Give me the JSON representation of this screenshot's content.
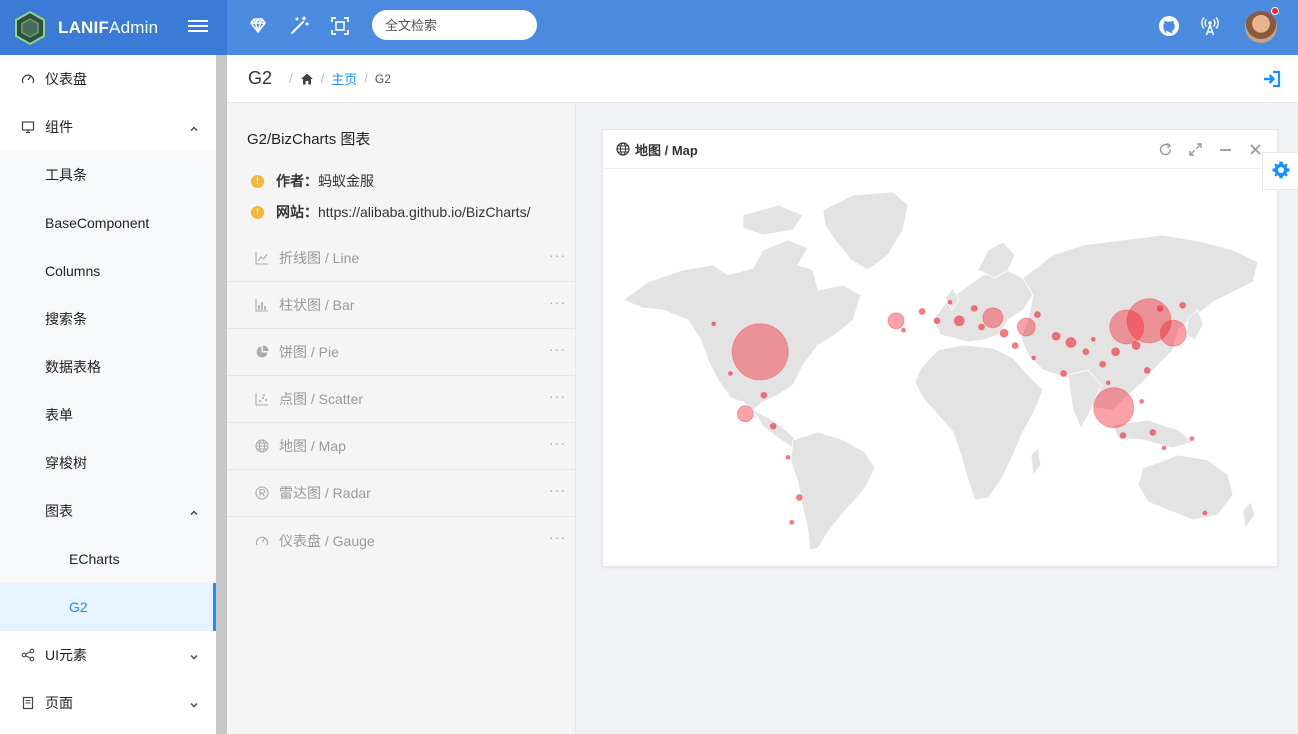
{
  "app": {
    "logo_bold": "LANIF",
    "logo_rest": "Admin"
  },
  "header": {
    "search_placeholder": "全文检索"
  },
  "sidebar": {
    "items": [
      {
        "label": "仪表盘",
        "icon": "dashboard-icon",
        "level": 1
      },
      {
        "label": "组件",
        "icon": "monitor-icon",
        "level": 1,
        "expanded": true
      },
      {
        "label": "工具条",
        "level": 2
      },
      {
        "label": "BaseComponent",
        "level": 2
      },
      {
        "label": "Columns",
        "level": 2
      },
      {
        "label": "搜索条",
        "level": 2
      },
      {
        "label": "数据表格",
        "level": 2
      },
      {
        "label": "表单",
        "level": 2
      },
      {
        "label": "穿梭树",
        "level": 2
      },
      {
        "label": "图表",
        "level": 2,
        "expanded": true
      },
      {
        "label": "ECharts",
        "level": 3
      },
      {
        "label": "G2",
        "level": 3,
        "active": true
      },
      {
        "label": "UI元素",
        "icon": "share-icon",
        "level": 1,
        "expanded": false
      },
      {
        "label": "页面",
        "icon": "page-icon",
        "level": 1,
        "expanded": false
      }
    ]
  },
  "breadcrumb": {
    "title": "G2",
    "sep": "/",
    "home_link": "主页",
    "current": "G2"
  },
  "list_panel": {
    "title": "G2/BizCharts 图表",
    "author_label": "作者：",
    "author_value": "蚂蚁金服",
    "site_label": "网站：",
    "site_value": "https://alibaba.github.io/BizCharts/",
    "more": "···",
    "items": [
      {
        "label": "折线图 / Line",
        "icon": "line-chart-icon"
      },
      {
        "label": "柱状图 / Bar",
        "icon": "bar-chart-icon"
      },
      {
        "label": "饼图 / Pie",
        "icon": "pie-chart-icon"
      },
      {
        "label": "点图 / Scatter",
        "icon": "scatter-chart-icon"
      },
      {
        "label": "地图 / Map",
        "icon": "globe-icon"
      },
      {
        "label": "雷达图 / Radar",
        "icon": "radar-icon"
      },
      {
        "label": "仪表盘 / Gauge",
        "icon": "gauge-icon"
      }
    ]
  },
  "card": {
    "title": "地图 / Map"
  },
  "colors": {
    "header": "#4a8be0",
    "logo_bg": "#3a7bd5",
    "accent": "#1890ff",
    "bubble": "#f5222d",
    "land": "#e3e3e3"
  },
  "chart_data": {
    "type": "bubble-map",
    "points": [
      {
        "lon": -87,
        "lat": 22,
        "size": 28
      },
      {
        "lon": 122,
        "lat": 32,
        "size": 22
      },
      {
        "lon": 110,
        "lat": 30,
        "size": 17
      },
      {
        "lon": 103,
        "lat": 4,
        "size": 20
      },
      {
        "lon": 135,
        "lat": 28,
        "size": 13
      },
      {
        "lon": 38,
        "lat": 33,
        "size": 10
      },
      {
        "lon": -95,
        "lat": 2,
        "size": 8
      },
      {
        "lon": -14,
        "lat": 32,
        "size": 8
      },
      {
        "lon": 56,
        "lat": 30,
        "size": 9
      },
      {
        "lon": 20,
        "lat": 32,
        "size": 5
      },
      {
        "lon": 80,
        "lat": 25,
        "size": 5
      },
      {
        "lon": 0,
        "lat": 35,
        "size": 3
      },
      {
        "lon": 8,
        "lat": 32,
        "size": 3
      },
      {
        "lon": 28,
        "lat": 36,
        "size": 3
      },
      {
        "lon": 32,
        "lat": 30,
        "size": 3
      },
      {
        "lon": 44,
        "lat": 28,
        "size": 4
      },
      {
        "lon": 50,
        "lat": 24,
        "size": 3
      },
      {
        "lon": 62,
        "lat": 34,
        "size": 3
      },
      {
        "lon": 72,
        "lat": 27,
        "size": 4
      },
      {
        "lon": 76,
        "lat": 15,
        "size": 3
      },
      {
        "lon": 88,
        "lat": 22,
        "size": 3
      },
      {
        "lon": 97,
        "lat": 18,
        "size": 3
      },
      {
        "lon": 104,
        "lat": 22,
        "size": 4
      },
      {
        "lon": 115,
        "lat": 24,
        "size": 4
      },
      {
        "lon": 121,
        "lat": 16,
        "size": 3
      },
      {
        "lon": 128,
        "lat": 36,
        "size": 3
      },
      {
        "lon": 140,
        "lat": 37,
        "size": 3
      },
      {
        "lon": 108,
        "lat": -5,
        "size": 3
      },
      {
        "lon": 124,
        "lat": -4,
        "size": 3
      },
      {
        "lon": 145,
        "lat": -6,
        "size": 2
      },
      {
        "lon": -112,
        "lat": 31,
        "size": 2
      },
      {
        "lon": -103,
        "lat": 15,
        "size": 2
      },
      {
        "lon": -85,
        "lat": 8,
        "size": 3
      },
      {
        "lon": -80,
        "lat": -2,
        "size": 3
      },
      {
        "lon": -72,
        "lat": -12,
        "size": 2
      },
      {
        "lon": -66,
        "lat": -25,
        "size": 3
      },
      {
        "lon": -70,
        "lat": -33,
        "size": 2
      },
      {
        "lon": -10,
        "lat": 29,
        "size": 2
      },
      {
        "lon": 15,
        "lat": 38,
        "size": 2
      },
      {
        "lon": 60,
        "lat": 20,
        "size": 2
      },
      {
        "lon": 92,
        "lat": 26,
        "size": 2
      },
      {
        "lon": 100,
        "lat": 12,
        "size": 2
      },
      {
        "lon": 118,
        "lat": 6,
        "size": 2
      },
      {
        "lon": 152,
        "lat": -30,
        "size": 2
      },
      {
        "lon": 130,
        "lat": -9,
        "size": 2
      }
    ]
  }
}
